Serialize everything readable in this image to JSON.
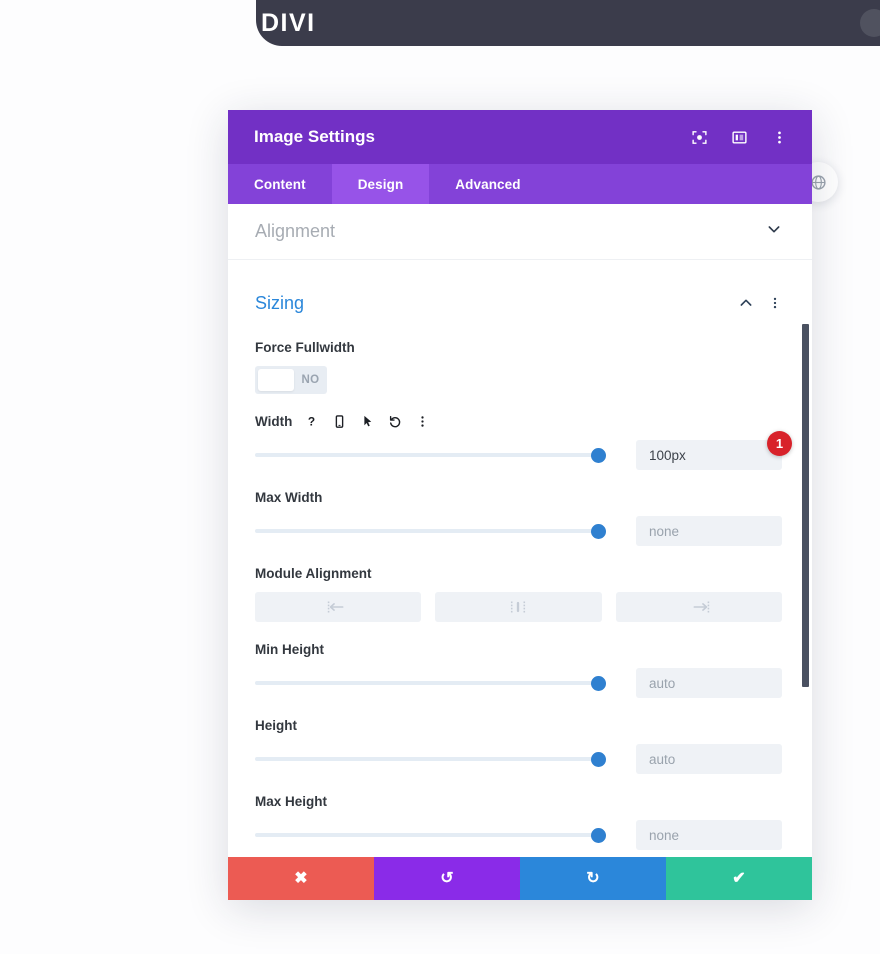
{
  "topbar": {
    "logo": "DIVI"
  },
  "floating": {
    "globe_icon": "globe-icon"
  },
  "modal": {
    "title": "Image Settings",
    "header_icons": [
      {
        "name": "focus-target-icon"
      },
      {
        "name": "panel-layout-icon"
      },
      {
        "name": "more-vertical-icon"
      }
    ],
    "tabs": [
      {
        "label": "Content",
        "active": false
      },
      {
        "label": "Design",
        "active": true
      },
      {
        "label": "Advanced",
        "active": false
      }
    ],
    "sections": {
      "alignment": {
        "title": "Alignment",
        "state": "collapsed",
        "chevron_icon": "chevron-down-icon"
      },
      "sizing": {
        "title": "Sizing",
        "state": "expanded",
        "chevron_icon": "chevron-up-icon",
        "more_icon": "more-vertical-icon"
      }
    },
    "fields": {
      "force_fullwidth": {
        "label": "Force Fullwidth",
        "toggle_value": "NO"
      },
      "width": {
        "label": "Width",
        "icons": [
          {
            "name": "help-icon",
            "glyph": "?"
          },
          {
            "name": "mobile-icon",
            "glyph": "mobile"
          },
          {
            "name": "cursor-icon",
            "glyph": "cursor"
          },
          {
            "name": "reset-icon",
            "glyph": "reset"
          },
          {
            "name": "more-vertical-icon",
            "glyph": "dots"
          }
        ],
        "slider_percent": 100,
        "value": "100px",
        "badge": "1"
      },
      "max_width": {
        "label": "Max Width",
        "slider_percent": 100,
        "placeholder": "none"
      },
      "module_alignment": {
        "label": "Module Alignment",
        "options": [
          {
            "name": "align-left-icon"
          },
          {
            "name": "align-center-icon"
          },
          {
            "name": "align-right-icon"
          }
        ]
      },
      "min_height": {
        "label": "Min Height",
        "slider_percent": 100,
        "placeholder": "auto"
      },
      "height": {
        "label": "Height",
        "slider_percent": 100,
        "placeholder": "auto"
      },
      "max_height": {
        "label": "Max Height",
        "slider_percent": 100,
        "placeholder": "none"
      }
    },
    "footer_buttons": [
      {
        "name": "close-button",
        "icon": "close-icon",
        "glyph": "✖",
        "color": "#ec5b53"
      },
      {
        "name": "undo-button",
        "icon": "undo-icon",
        "glyph": "↺",
        "color": "#8a2be8"
      },
      {
        "name": "redo-button",
        "icon": "redo-icon",
        "glyph": "↻",
        "color": "#2b87da"
      },
      {
        "name": "save-button",
        "icon": "check-icon",
        "glyph": "✔",
        "color": "#2fc49b"
      }
    ]
  }
}
